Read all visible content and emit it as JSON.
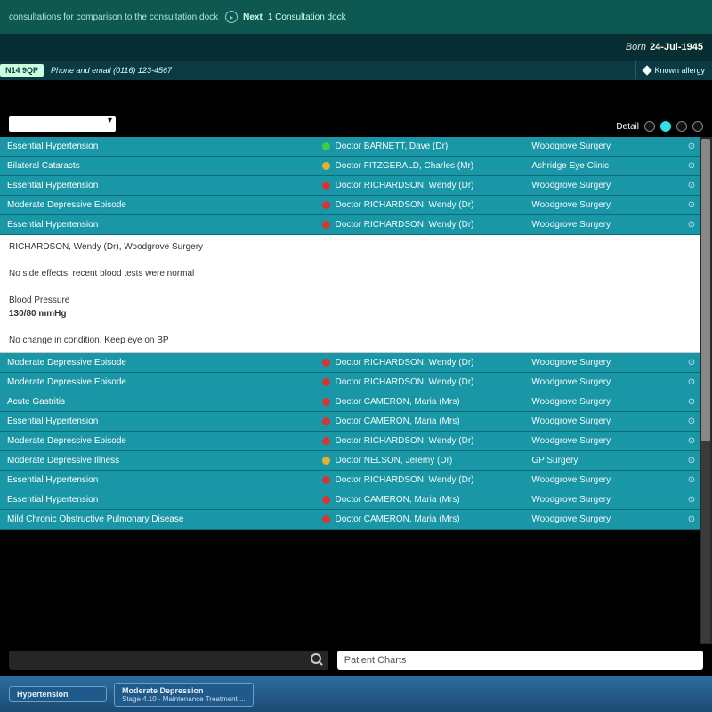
{
  "topbar": {
    "hint": "consultations for comparison to the consultation dock",
    "next_label": "Next",
    "next_count": "1 Consultation dock"
  },
  "patient": {
    "born_label": "Born",
    "born_value": "24-Jul-1945"
  },
  "info": {
    "postcode": "N14 9QP",
    "contact": "Phone and email (0116) 123-4567",
    "allergy": "Known allergy"
  },
  "list": {
    "detail_label": "Detail",
    "rows": [
      {
        "title": "Essential Hypertension",
        "dot": "green",
        "doctor": "Doctor BARNETT, Dave (Dr)",
        "loc": "Woodgrove Surgery"
      },
      {
        "title": "Bilateral Cataracts",
        "dot": "amber",
        "doctor": "Doctor FITZGERALD, Charles (Mr)",
        "loc": "Ashridge Eye Clinic"
      },
      {
        "title": "Essential Hypertension",
        "dot": "red",
        "doctor": "Doctor RICHARDSON, Wendy (Dr)",
        "loc": "Woodgrove Surgery"
      },
      {
        "title": "Moderate Depressive Episode",
        "dot": "red",
        "doctor": "Doctor RICHARDSON, Wendy (Dr)",
        "loc": "Woodgrove Surgery"
      },
      {
        "title": "Essential Hypertension",
        "dot": "red",
        "doctor": "Doctor RICHARDSON, Wendy (Dr)",
        "loc": "Woodgrove Surgery"
      },
      {
        "title": "Moderate Depressive Episode",
        "dot": "red",
        "doctor": "Doctor RICHARDSON, Wendy (Dr)",
        "loc": "Woodgrove Surgery"
      },
      {
        "title": "Moderate Depressive Episode",
        "dot": "red",
        "doctor": "Doctor RICHARDSON, Wendy (Dr)",
        "loc": "Woodgrove Surgery"
      },
      {
        "title": "Acute Gastritis",
        "dot": "red",
        "doctor": "Doctor CAMERON, Maria (Mrs)",
        "loc": "Woodgrove Surgery"
      },
      {
        "title": "Essential Hypertension",
        "dot": "red",
        "doctor": "Doctor CAMERON, Maria (Mrs)",
        "loc": "Woodgrove Surgery"
      },
      {
        "title": "Moderate Depressive Episode",
        "dot": "red",
        "doctor": "Doctor RICHARDSON, Wendy (Dr)",
        "loc": "Woodgrove Surgery"
      },
      {
        "title": "Moderate Depressive Illness",
        "dot": "amber",
        "doctor": "Doctor NELSON, Jeremy (Dr)",
        "loc": "GP Surgery"
      },
      {
        "title": "Essential Hypertension",
        "dot": "red",
        "doctor": "Doctor RICHARDSON, Wendy (Dr)",
        "loc": "Woodgrove Surgery"
      },
      {
        "title": "Essential Hypertension",
        "dot": "red",
        "doctor": "Doctor CAMERON, Maria (Mrs)",
        "loc": "Woodgrove Surgery"
      },
      {
        "title": "Mild Chronic Obstructive Pulmonary Disease",
        "dot": "red",
        "doctor": "Doctor CAMERON, Maria (Mrs)",
        "loc": "Woodgrove Surgery"
      }
    ],
    "expanded": {
      "who": "RICHARDSON, Wendy (Dr), Woodgrove Surgery",
      "history": "No side effects, recent blood tests were normal",
      "exam_label": "Blood Pressure",
      "exam_value": "130/80 mmHg",
      "note": "No change in condition. Keep eye on BP"
    }
  },
  "search": {
    "charts_label": "Patient Charts"
  },
  "chips": [
    {
      "l1": "Hypertension",
      "l2": ""
    },
    {
      "l1": "Moderate Depression",
      "l2": "Stage 4.10 - Maintenance Treatment ..."
    }
  ]
}
